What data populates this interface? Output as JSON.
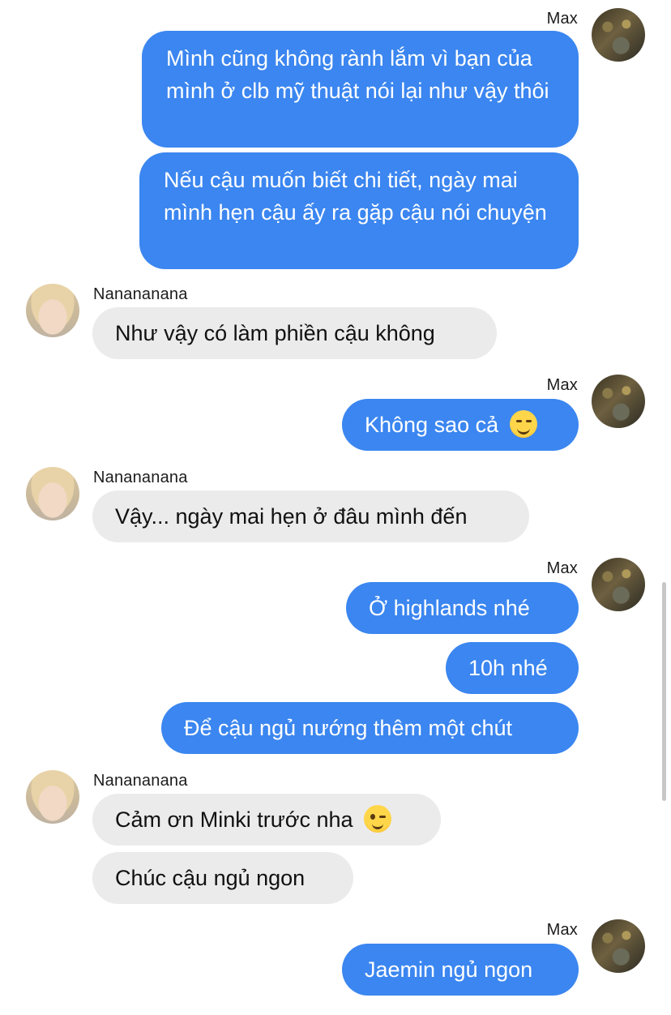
{
  "participants": {
    "me": "Max",
    "other": "Nanananana"
  },
  "messages": [
    {
      "sender": "Max",
      "text": "Mình cũng không rành lắm vì bạn của mình ở clb mỹ thuật nói lại như vậy thôi"
    },
    {
      "sender": "Max",
      "text": "Nếu cậu muốn biết chi tiết, ngày mai mình hẹn cậu ấy ra gặp cậu nói chuyện"
    },
    {
      "sender": "Nanananana",
      "text": "Như vậy có làm phiền cậu không"
    },
    {
      "sender": "Max",
      "text": "Không sao cả",
      "emoji": "smiling-face-icon"
    },
    {
      "sender": "Nanananana",
      "text": "Vậy... ngày mai hẹn ở đâu mình đến"
    },
    {
      "sender": "Max",
      "text": "Ở highlands nhé"
    },
    {
      "sender": "Max",
      "text": "10h nhé"
    },
    {
      "sender": "Max",
      "text": "Để cậu ngủ nướng thêm một chút"
    },
    {
      "sender": "Nanananana",
      "text": "Cảm ơn Minki trước nha",
      "emoji": "winking-face-icon"
    },
    {
      "sender": "Nanananana",
      "text": "Chúc cậu ngủ ngon"
    },
    {
      "sender": "Max",
      "text": "Jaemin ngủ ngon"
    }
  ],
  "colors": {
    "outgoing_bubble": "#3b86f0",
    "incoming_bubble": "#ebebeb",
    "background": "#ffffff"
  }
}
